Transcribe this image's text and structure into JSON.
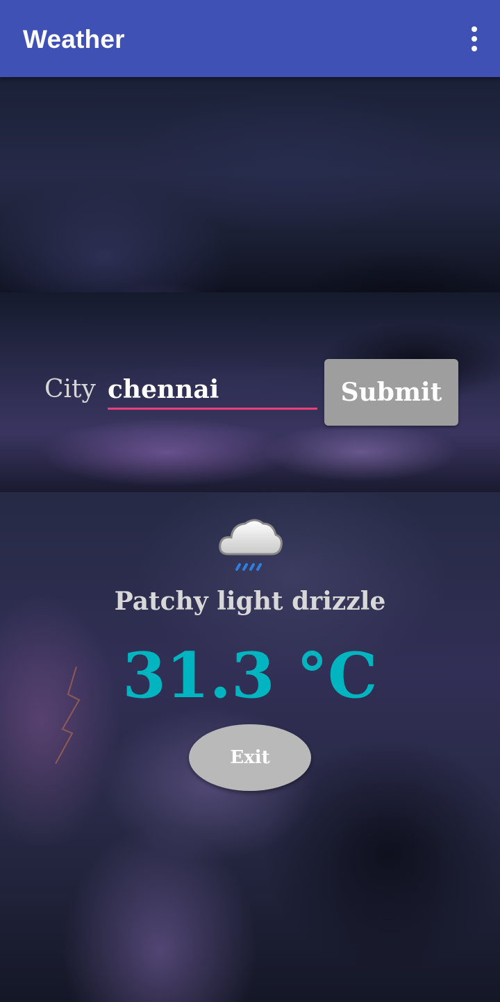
{
  "app_bar": {
    "title": "Weather",
    "menu_icon": "overflow-menu-icon",
    "color": "#3f51b5"
  },
  "search": {
    "city_label": "City",
    "city_value": "chennai",
    "submit_label": "Submit"
  },
  "result": {
    "icon": "cloud-drizzle-icon",
    "condition": "Patchy light drizzle",
    "temperature": "31.3 °C",
    "temperature_color": "#00b5bf"
  },
  "exit_label": "Exit"
}
